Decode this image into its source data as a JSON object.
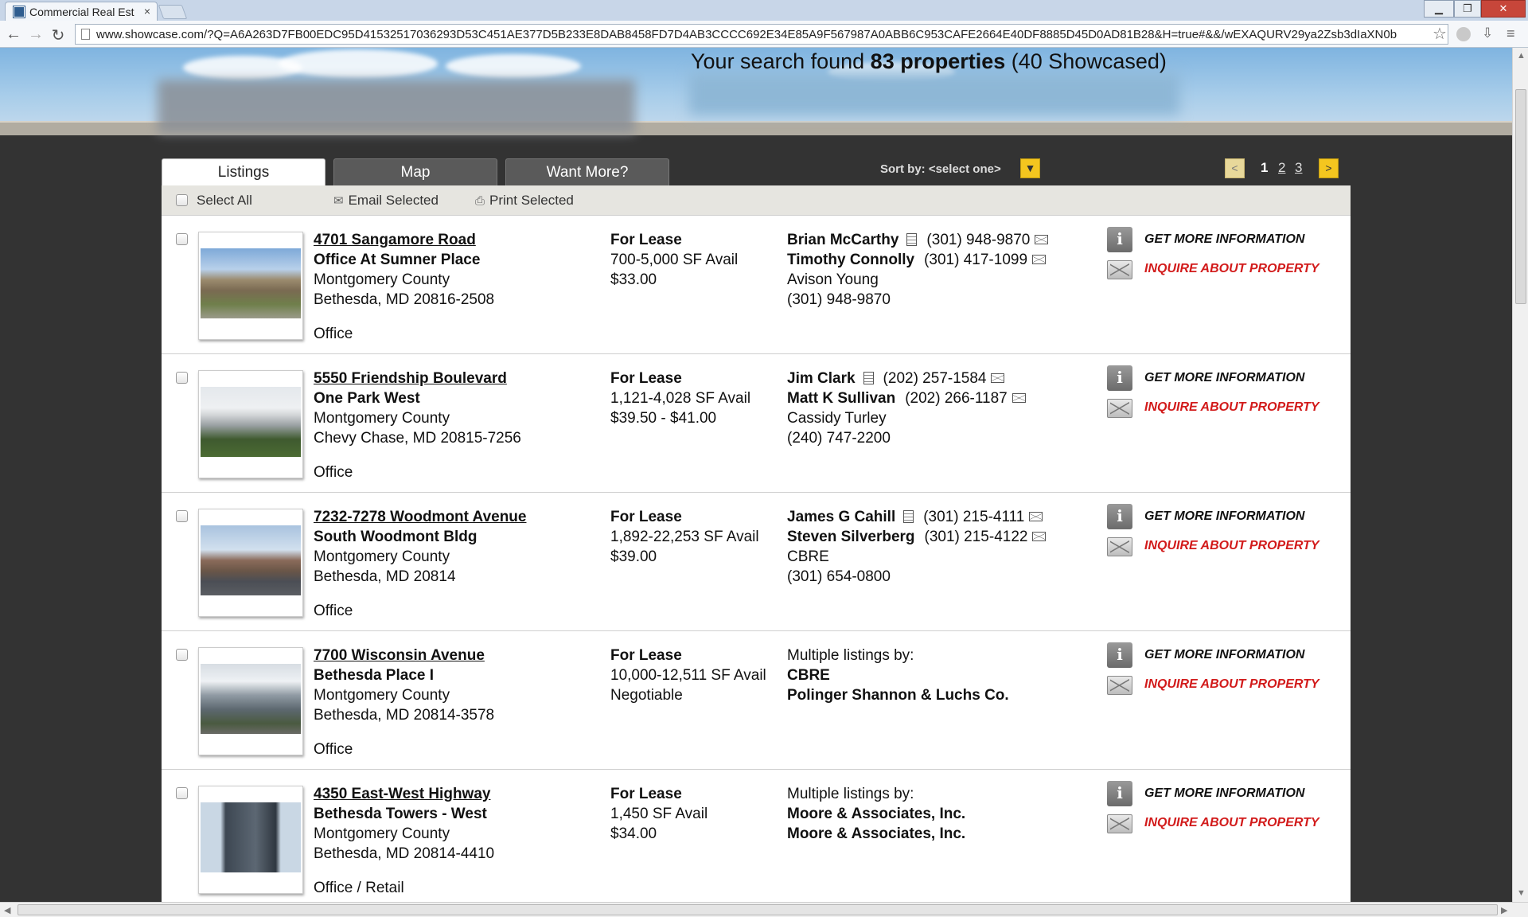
{
  "browser": {
    "tab_title": "Commercial Real Est",
    "tab_close": "×",
    "url": "www.showcase.com/?Q=A6A263D7FB00EDC95D41532517036293D53C451AE377D5B233E8DAB8458FD7D4AB3CCCC692E34E85A9F567987A0ABB6C953CAFE2664E40DF8885D45D0AD81B28&H=true#&&/wEXAQURV29ya2Zsb3dIaXN0b",
    "back": "←",
    "forward": "→",
    "reload": "↻",
    "star": "☆",
    "minimize": "▁",
    "maximize": "❐",
    "close": "✕"
  },
  "header": {
    "summary_prefix": "Your search found ",
    "summary_count": "83 properties",
    "summary_suffix": " (40 Showcased)"
  },
  "tabs": [
    {
      "label": "Listings",
      "active": true
    },
    {
      "label": "Map",
      "active": false
    },
    {
      "label": "Want More?",
      "active": false
    }
  ],
  "sort": {
    "label": "Sort by: <select one>",
    "arrow": "▼"
  },
  "pagination": {
    "prev": "<",
    "next": ">",
    "pages": [
      "1",
      "2",
      "3"
    ],
    "current": "1"
  },
  "actions": {
    "select_all": "Select All",
    "email_selected": "Email Selected",
    "print_selected": "Print Selected"
  },
  "buttons": {
    "get_more_info": "GET MORE INFORMATION",
    "inquire": "INQUIRE ABOUT PROPERTY",
    "info_glyph": "i"
  },
  "listings": [
    {
      "address": "4701 Sangamore Road",
      "building": "Office At Sumner Place",
      "county": "Montgomery County",
      "city": "Bethesda, MD 20816-2508",
      "type": "Office",
      "lease": "For Lease",
      "avail": "700-5,000 SF Avail",
      "price": "$33.00",
      "contact1": "Brian McCarthy",
      "phone1": "(301) 948-9870",
      "contact2": "Timothy Connolly",
      "phone2": "(301) 417-1099",
      "firm": "Avison Young",
      "firm_phone": "(301) 948-9870"
    },
    {
      "address": "5550 Friendship Boulevard",
      "building": "One Park West",
      "county": "Montgomery County",
      "city": "Chevy Chase, MD 20815-7256",
      "type": "Office",
      "lease": "For Lease",
      "avail": "1,121-4,028 SF Avail",
      "price": "$39.50 - $41.00",
      "contact1": "Jim Clark",
      "phone1": "(202) 257-1584",
      "contact2": "Matt K Sullivan",
      "phone2": "(202) 266-1187",
      "firm": "Cassidy Turley",
      "firm_phone": "(240) 747-2200"
    },
    {
      "address": "7232-7278 Woodmont Avenue",
      "building": "South Woodmont Bldg",
      "county": "Montgomery County",
      "city": "Bethesda, MD 20814",
      "type": "Office",
      "lease": "For Lease",
      "avail": "1,892-22,253 SF Avail",
      "price": "$39.00",
      "contact1": "James G Cahill",
      "phone1": "(301) 215-4111",
      "contact2": "Steven Silverberg",
      "phone2": "(301) 215-4122",
      "firm": "CBRE",
      "firm_phone": "(301) 654-0800"
    },
    {
      "address": "7700 Wisconsin Avenue",
      "building": "Bethesda Place I",
      "county": "Montgomery County",
      "city": "Bethesda, MD 20814-3578",
      "type": "Office",
      "lease": "For Lease",
      "avail": "10,000-12,511 SF Avail",
      "price": "Negotiable",
      "multiple_label": "Multiple listings by:",
      "firm_a": "CBRE",
      "firm_b": "Polinger Shannon & Luchs Co."
    },
    {
      "address": "4350 East-West Highway",
      "building": "Bethesda Towers - West",
      "county": "Montgomery County",
      "city": "Bethesda, MD 20814-4410",
      "type": "Office / Retail",
      "lease": "For Lease",
      "avail": "1,450 SF Avail",
      "price": "$34.00",
      "multiple_label": "Multiple listings by:",
      "firm_a": "Moore & Associates, Inc.",
      "firm_b": "Moore & Associates, Inc."
    }
  ],
  "colors": {
    "inquire_red": "#d21b1b",
    "pager_yellow": "#f4c61f",
    "dark_bg": "#333333"
  }
}
